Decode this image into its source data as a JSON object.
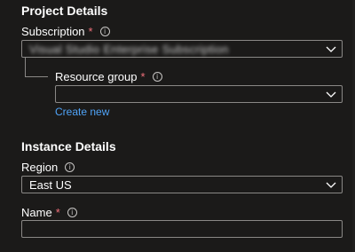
{
  "project": {
    "title": "Project Details",
    "subscription": {
      "label": "Subscription",
      "required": "*",
      "info": "i",
      "value": "Visual Studio Enterprise Subscription"
    },
    "resource_group": {
      "label": "Resource group",
      "required": "*",
      "info": "i",
      "value": "",
      "create_new": "Create new"
    }
  },
  "instance": {
    "title": "Instance Details",
    "region": {
      "label": "Region",
      "info": "i",
      "value": "East US"
    },
    "name": {
      "label": "Name",
      "required": "*",
      "info": "i",
      "value": ""
    }
  },
  "icons": {
    "dropdown": "chevron-down-icon",
    "info": "info-icon"
  },
  "colors": {
    "background": "#1b1a19",
    "required": "#f1707b",
    "link": "#4fa3f7",
    "border": "#8a8886"
  }
}
